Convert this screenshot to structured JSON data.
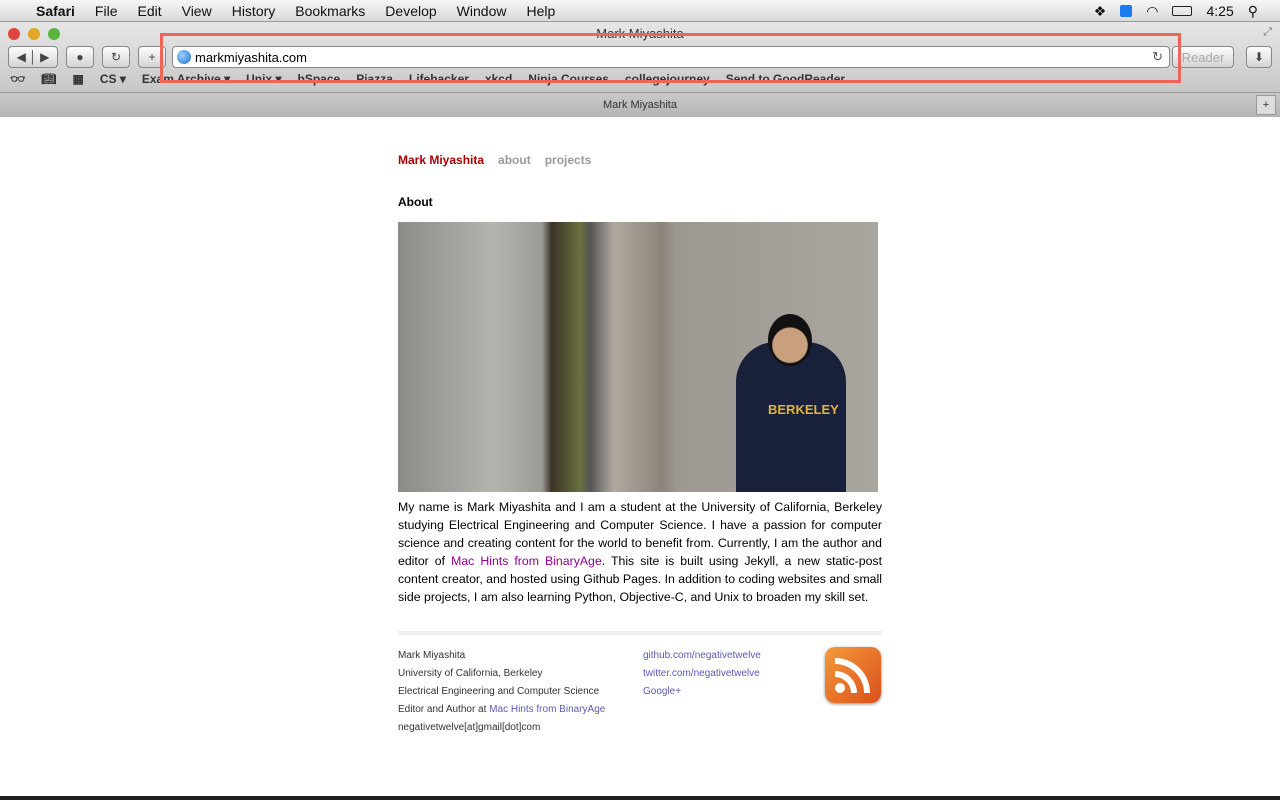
{
  "menubar": {
    "app": "Safari",
    "items": [
      "File",
      "Edit",
      "View",
      "History",
      "Bookmarks",
      "Develop",
      "Window",
      "Help"
    ],
    "clock": "4:25"
  },
  "window": {
    "title": "Mark Miyashita",
    "url": "markmiyashita.com",
    "reader": "Reader",
    "bookmarks": [
      "CS ▾",
      "Exam Archive ▾",
      "Unix ▾",
      "bSpace",
      "Piazza",
      "Lifehacker",
      "xkcd",
      "Ninja Courses",
      "collegejourney",
      "Send to GoodReader"
    ],
    "tab": "Mark Miyashita"
  },
  "page": {
    "nav": {
      "home": "Mark Miyashita",
      "about": "about",
      "projects": "projects"
    },
    "heading": "About",
    "photo_text": "BERKELEY",
    "bio_1": "My name is Mark Miyashita and I am a student at the University of California, Berkeley studying Electrical Engineering and Computer Science. I have a passion for computer science and creating content for the world to benefit from. Currently, I am the author and editor of ",
    "bio_link": "Mac Hints from BinaryAge",
    "bio_2": ". This site is built using Jekyll, a new static-post content creator, and hosted using Github Pages. In addition to coding websites and small side projects, I am also learning Python, Objective-C, and Unix to broaden my skill set.",
    "footer": {
      "name": "Mark Miyashita",
      "school": "University of California, Berkeley",
      "major": "Electrical Engineering and Computer Science",
      "editor_prefix": "Editor and Author at ",
      "editor_link": "Mac Hints from BinaryAge",
      "email": "negativetwelve[at]gmail[dot]com",
      "links": [
        "github.com/negativetwelve",
        "twitter.com/negativetwelve",
        "Google+"
      ]
    }
  },
  "colors": {
    "accent": "#aa0000",
    "highlight": "#f0645a",
    "link": "#900090"
  }
}
